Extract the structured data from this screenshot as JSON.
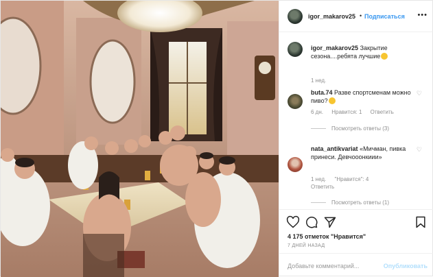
{
  "header": {
    "username": "igor_makarov25",
    "separator": "•",
    "follow_label": "Подписаться",
    "more_label": "•••"
  },
  "caption": {
    "username": "igor_makarov25",
    "text": "Закрытие сезона....ребята лучшие",
    "time": "1 нед."
  },
  "comments": [
    {
      "username": "buta.74",
      "text": "Разве спортсменам можно пиво?",
      "time": "6 дн.",
      "likes": "Нравится: 1",
      "reply": "Ответить",
      "view_replies": "Посмотреть ответы (3)"
    },
    {
      "username": "nata_antikvariat",
      "text": "«Мичман, пивка принеси. Девчооонкиии»",
      "time": "1 нед.",
      "likes": "\"Нравится\": 4",
      "reply": "Ответить",
      "view_replies": "Посмотреть ответы (1)"
    }
  ],
  "actions": {
    "likes_text": "4 175 отметок \"Нравится\"",
    "time_ago": "7 дней назад"
  },
  "add_comment": {
    "placeholder": "Добавьте комментарий...",
    "publish_label": "Опубликовать"
  },
  "colors": {
    "accent": "#3897f0",
    "muted": "#8e8e8e",
    "publish_disabled": "#b2dffc"
  },
  "icons": [
    "heart-icon",
    "comment-icon",
    "share-icon",
    "bookmark-icon",
    "more-icon"
  ]
}
